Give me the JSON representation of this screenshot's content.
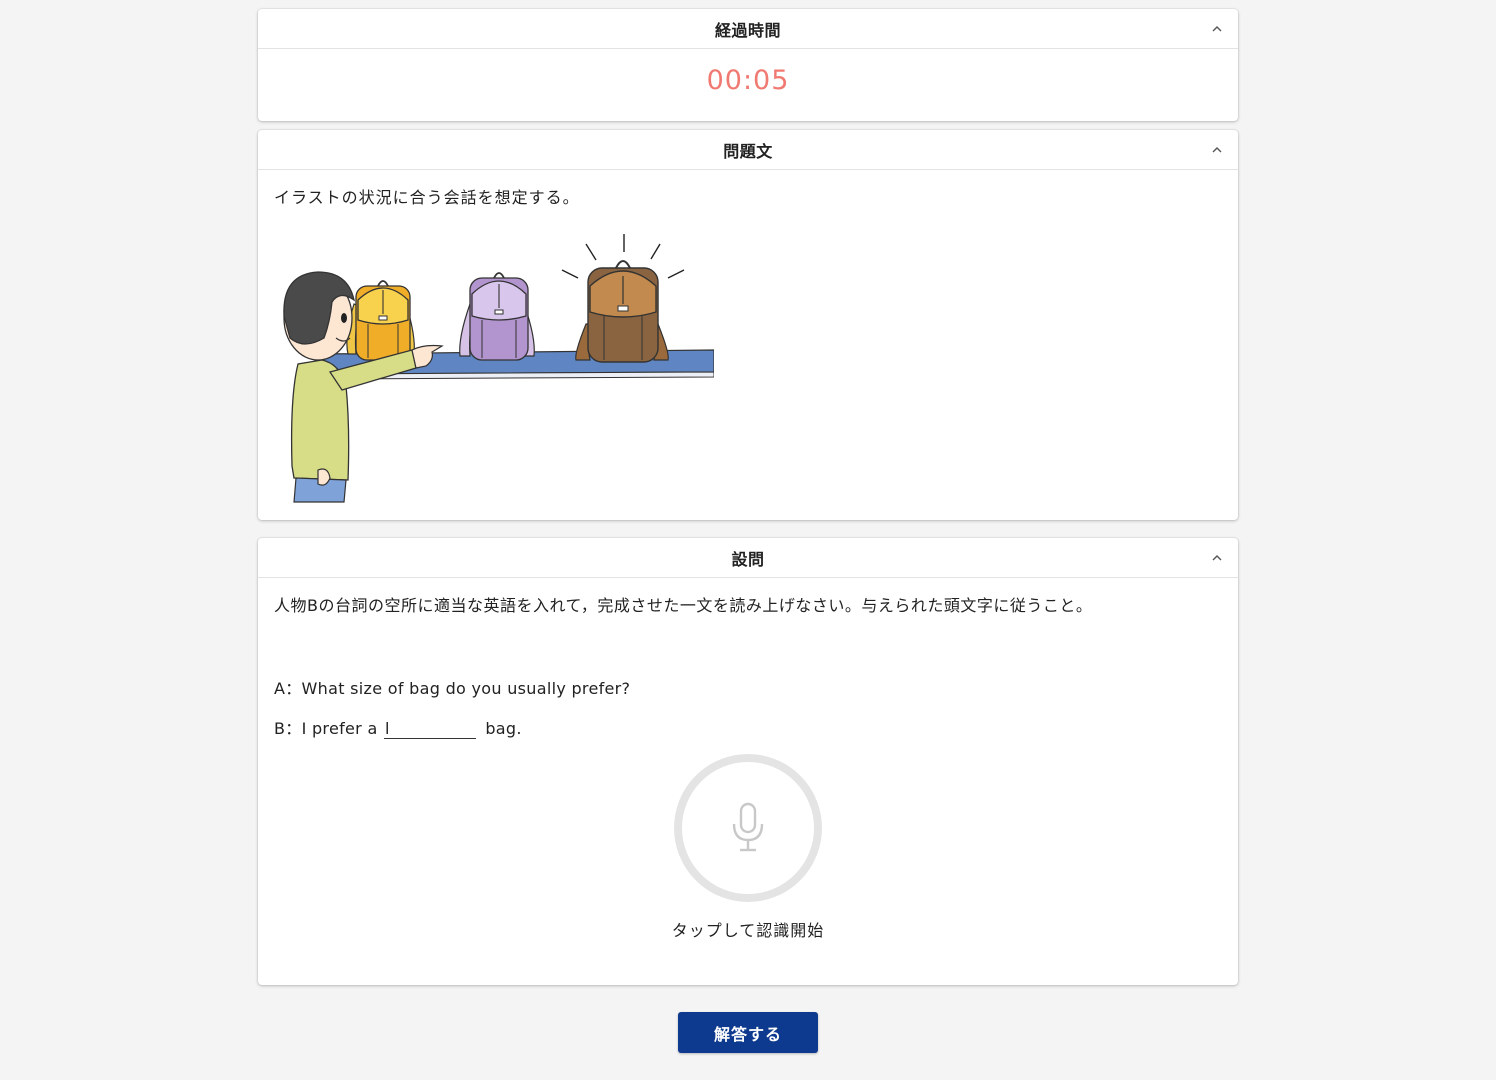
{
  "timer_card": {
    "title": "経過時間",
    "value": "00:05"
  },
  "problem_card": {
    "title": "問題文",
    "text": "イラストの状況に合う会話を想定する。",
    "illustration_icon": "boy-pointing-at-backpacks-illustration"
  },
  "question_card": {
    "title": "設問",
    "instruction": "人物Bの台詞の空所に適当な英語を入れて，完成させた一文を読み上げなさい。与えられた頭文字に従うこと。",
    "line_a": "A：What size of bag do you usually prefer?",
    "line_b_prefix": "B：I prefer a",
    "line_b_blank": "l",
    "line_b_suffix": "bag.",
    "mic_icon": "microphone-icon",
    "mic_caption": "タップして認識開始"
  },
  "submit_label": "解答する",
  "colors": {
    "timer": "#f07a72",
    "submit": "#0d3a8e",
    "background": "#f4f4f4"
  }
}
